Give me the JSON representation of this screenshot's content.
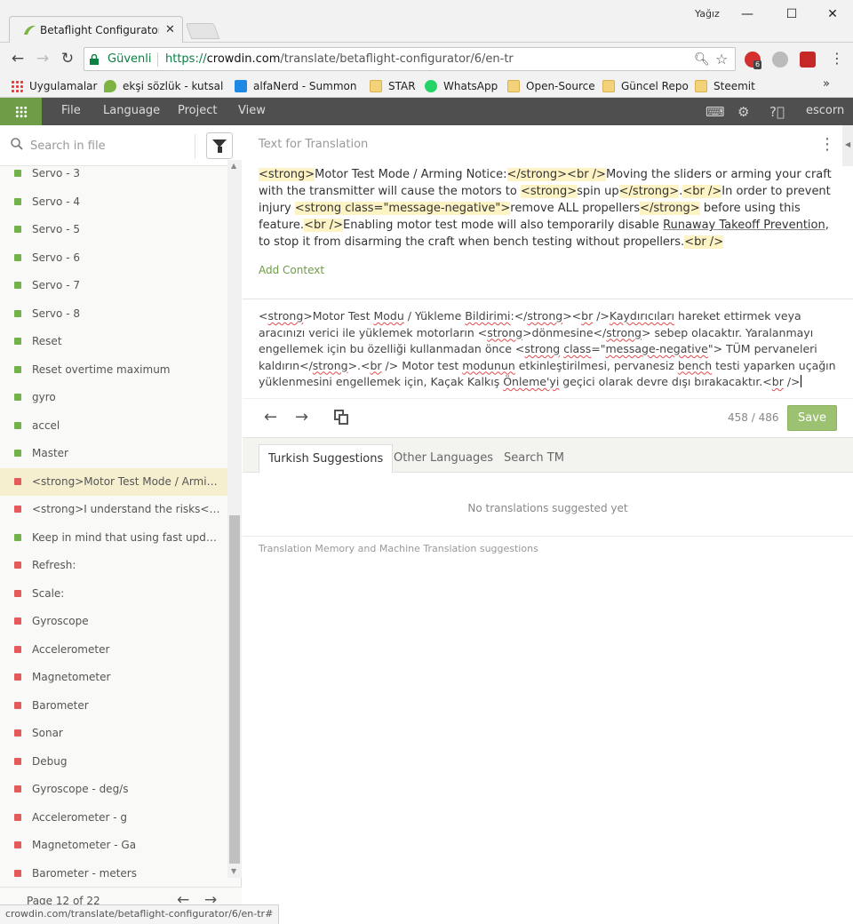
{
  "browser": {
    "tab_title": "Betaflight Configurator A",
    "profile": "Yağız",
    "secure_label": "Güvenli",
    "url_scheme": "https://",
    "url_host": "crowdin.com",
    "url_path": "/translate/betaflight-configurator/6/en-tr",
    "extension_badge": "6",
    "bookmarks": [
      {
        "label": "Uygulamalar",
        "icon": "apps-icon"
      },
      {
        "label": "ekşi sözlük - kutsal b",
        "icon": "leaf-icon"
      },
      {
        "label": "alfaNerd - Summone",
        "icon": "blog-icon"
      },
      {
        "label": "STAR",
        "icon": "folder-icon"
      },
      {
        "label": "WhatsApp",
        "icon": "whatsapp-icon"
      },
      {
        "label": "Open-Source",
        "icon": "folder-icon"
      },
      {
        "label": "Güncel Repo",
        "icon": "folder-icon"
      },
      {
        "label": "Steemit",
        "icon": "folder-icon"
      }
    ],
    "more_bookmarks": "»",
    "status_url": "crowdin.com/translate/betaflight-configurator/6/en-tr#"
  },
  "app": {
    "menu": [
      "File",
      "Language",
      "Project",
      "View"
    ],
    "user": "escorn",
    "colors": {
      "accent": "#6e9c47",
      "bar": "#4f4f4f",
      "save": "#9cc271"
    }
  },
  "sidebar": {
    "search_placeholder": "Search in file",
    "items": [
      {
        "text": "Servo - 3",
        "status": "translated"
      },
      {
        "text": "Servo - 4",
        "status": "translated"
      },
      {
        "text": "Servo - 5",
        "status": "translated"
      },
      {
        "text": "Servo - 6",
        "status": "translated"
      },
      {
        "text": "Servo - 7",
        "status": "translated"
      },
      {
        "text": "Servo - 8",
        "status": "translated"
      },
      {
        "text": "Reset",
        "status": "translated"
      },
      {
        "text": "Reset overtime maximum",
        "status": "translated"
      },
      {
        "text": "gyro",
        "status": "translated"
      },
      {
        "text": "accel",
        "status": "translated"
      },
      {
        "text": "Master",
        "status": "translated"
      },
      {
        "text": "<strong>Motor Test Mode / Arming Notice:</strong>",
        "status": "untranslated",
        "active": true
      },
      {
        "text": "<strong>I understand the risks</strong>",
        "status": "untranslated"
      },
      {
        "text": "Keep in mind that using fast update rates",
        "status": "translated"
      },
      {
        "text": "Refresh:",
        "status": "untranslated"
      },
      {
        "text": "Scale:",
        "status": "untranslated"
      },
      {
        "text": "Gyroscope",
        "status": "untranslated"
      },
      {
        "text": "Accelerometer",
        "status": "untranslated"
      },
      {
        "text": "Magnetometer",
        "status": "untranslated"
      },
      {
        "text": "Barometer",
        "status": "untranslated"
      },
      {
        "text": "Sonar",
        "status": "untranslated"
      },
      {
        "text": "Debug",
        "status": "untranslated"
      },
      {
        "text": "Gyroscope - deg/s",
        "status": "untranslated"
      },
      {
        "text": "Accelerometer - g",
        "status": "untranslated"
      },
      {
        "text": "Magnetometer - Ga",
        "status": "untranslated"
      },
      {
        "text": "Barometer - meters",
        "status": "untranslated"
      }
    ],
    "page_label": "Page 12 of 22"
  },
  "editor": {
    "source_header": "Text for Translation",
    "source": {
      "t1": "<strong>",
      "t2": "Motor Test Mode / Arming Notice:",
      "t3": "</strong>",
      "t4": "<br />",
      "t5": "Moving the sliders or arming your craft with the transmitter will cause the motors to ",
      "t6": "<strong>",
      "t7": "spin up",
      "t8": "</strong>",
      "t9": ".",
      "t10": "<br />",
      "t11": "In order to prevent injury ",
      "t12": "<strong class=\"message-negative\">",
      "t13": "remove ALL propellers",
      "t14": "</strong>",
      "t15": " before using this feature.",
      "t16": "<br />",
      "t17": "Enabling motor test mode will also temporarily disable ",
      "t18": "Runaway Takeoff Prevention",
      "t19": ", to stop it from disarming the craft when bench testing without propellers.",
      "t20": "<br />"
    },
    "add_context": "Add Context",
    "translation": {
      "p1": "<",
      "w1": "strong",
      "p2": ">Motor Test ",
      "w2": "Modu",
      "p3": " / Yükleme ",
      "w3": "Bildirimi",
      "p4": ":</",
      "w4": "strong",
      "p5": "><",
      "w5": "br",
      "p6": " />",
      "w6": "Kaydırıcıları",
      "p7": " hareket ettirmek veya aracınızı verici ile yüklemek motorların <",
      "w7": "strong",
      "p8": ">dönmesine</",
      "w8": "strong",
      "p9": "> sebep olacaktır. Yaralanmayı engellemek için bu özelliği kullanmadan önce <",
      "w9": "strong",
      "p10": " ",
      "w10": "class",
      "p11": "=\"",
      "w11": "message-negative",
      "p12": "\"> TÜM pervaneleri kaldırın</",
      "w12": "strong",
      "p13": ">.<",
      "w13": "br",
      "p14": " /> Motor test ",
      "w14": "modunun",
      "p15": " etkinleştirilmesi, pervanesiz ",
      "w15": "bench",
      "p16": " testi yaparken uçağın yüklenmesini engellemek için, Kaçak Kalkış ",
      "w16": "Önleme'yi",
      "p17": " geçici olarak devre dışı bırakacaktır.<",
      "w17": "br",
      "p18": " />"
    },
    "char_count": "458 / 486",
    "save_label": "Save"
  },
  "suggestions": {
    "tabs": [
      "Turkish Suggestions",
      "Other Languages",
      "Search TM"
    ],
    "empty_text": "No translations suggested yet",
    "tm_label": "Translation Memory and Machine Translation suggestions"
  }
}
